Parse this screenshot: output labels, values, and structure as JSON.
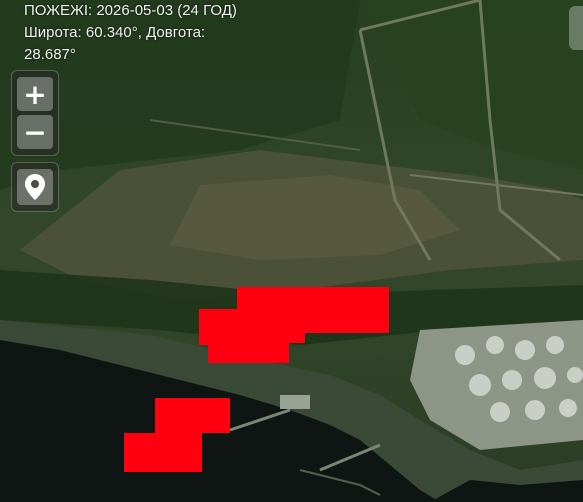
{
  "header": {
    "title": "ПОЖЕЖІ: 2026-05-03 (24 ГОД)",
    "lat_line": "Широта: 60.340°, Довгота:",
    "lon_line": "28.687°"
  },
  "controls": {
    "zoom_in": "+",
    "zoom_out": "−",
    "locate_icon": "location-pin-icon"
  },
  "colors": {
    "fire": "#ff0010",
    "water": "#0f1512",
    "forest": "#243a20"
  }
}
